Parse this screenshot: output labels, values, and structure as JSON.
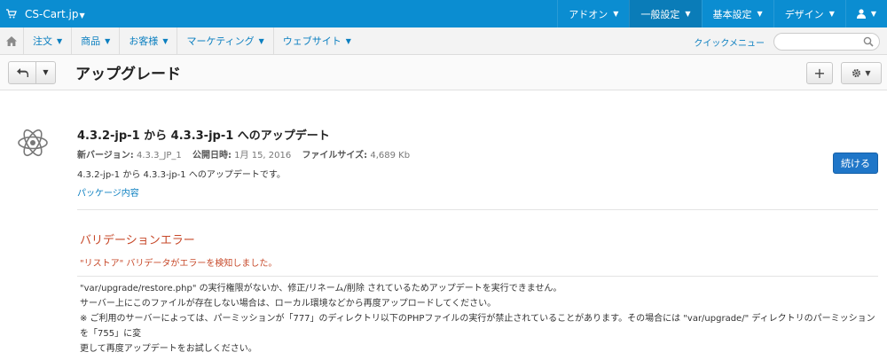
{
  "topbar": {
    "brand": "CS-Cart.jp",
    "nav": [
      {
        "label": "アドオン"
      },
      {
        "label": "一般設定"
      },
      {
        "label": "基本設定"
      },
      {
        "label": "デザイン"
      }
    ]
  },
  "subnav": {
    "items": [
      {
        "label": "注文"
      },
      {
        "label": "商品"
      },
      {
        "label": "お客様"
      },
      {
        "label": "マーケティング"
      },
      {
        "label": "ウェブサイト"
      }
    ],
    "quick_menu": "クイックメニュー",
    "search_placeholder": ""
  },
  "page": {
    "title": "アップグレード"
  },
  "upgrade": {
    "title": "4.3.2-jp-1 から 4.3.3-jp-1 へのアップデート",
    "version_label": "新バージョン:",
    "version_value": "4.3.3_JP_1",
    "date_label": "公開日時:",
    "date_value": "1月 15, 2016",
    "size_label": "ファイルサイズ:",
    "size_value": "4,689 Kb",
    "description": "4.3.2-jp-1 から 4.3.3-jp-1 へのアップデートです。",
    "package_link": "パッケージ内容",
    "continue_button": "続ける"
  },
  "validation": {
    "title": "バリデーションエラー",
    "message": "\"リストア\" バリデータがエラーを検知しました。",
    "detail_lines": [
      "\"var/upgrade/restore.php\" の実行権限がないか、修正/リネーム/削除 されているためアップデートを実行できません。",
      "サーバー上にこのファイルが存在しない場合は、ローカル環境などから再度アップロードしてください。",
      "※ ご利用のサーバーによっては、パーミッションが「777」のディレクトリ以下のPHPファイルの実行が禁止されていることがあります。その場合には \"var/upgrade/\" ディレクトリのパーミッションを「755」に変",
      "更して再度アップデートをお試しください。"
    ]
  }
}
